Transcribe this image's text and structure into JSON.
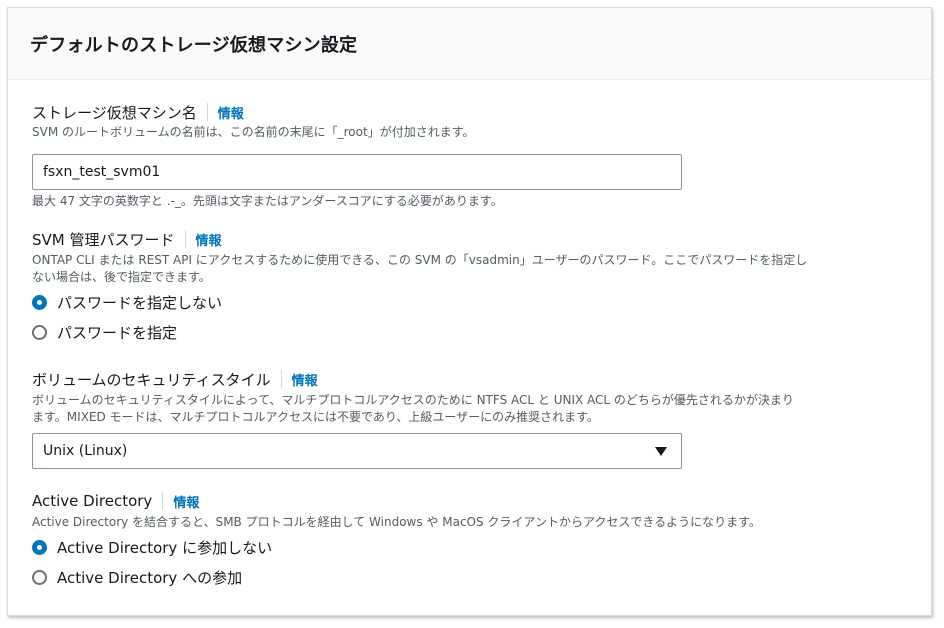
{
  "panel": {
    "title": "デフォルトのストレージ仮想マシン設定"
  },
  "info_label": "情報",
  "svm_name": {
    "label": "ストレージ仮想マシン名",
    "description": "SVM のルートボリュームの名前は、この名前の末尾に「_root」が付加されます。",
    "value": "fsxn_test_svm01",
    "hint": "最大 47 文字の英数字と .-_。先頭は文字またはアンダースコアにする必要があります。"
  },
  "svm_password": {
    "label": "SVM 管理パスワード",
    "description_line1": "ONTAP CLI または REST API にアクセスするために使用できる、この SVM の「vsadmin」ユーザーのパスワード。ここでパスワードを指定し",
    "description_line2": "ない場合は、後で指定できます。",
    "options": [
      {
        "label": "パスワードを指定しない",
        "selected": true
      },
      {
        "label": "パスワードを指定",
        "selected": false
      }
    ]
  },
  "security_style": {
    "label": "ボリュームのセキュリティスタイル",
    "description_line1": "ボリュームのセキュリティスタイルによって、マルチプロトコルアクセスのために NTFS ACL と UNIX ACL のどちらが優先されるかが決まり",
    "description_line2": "ます。MIXED モードは、マルチプロトコルアクセスには不要であり、上級ユーザーにのみ推奨されます。",
    "selected": "Unix (Linux)"
  },
  "active_directory": {
    "label": "Active Directory",
    "description": "Active Directory を結合すると、SMB プロトコルを経由して Windows や MacOS クライアントからアクセスできるようになります。",
    "options": [
      {
        "label": "Active Directory に参加しない",
        "selected": true
      },
      {
        "label": "Active Directory への参加",
        "selected": false
      }
    ]
  },
  "colors": {
    "accent": "#0073bb",
    "text": "#16191f",
    "secondary_text": "#545b64",
    "border": "#879596"
  }
}
